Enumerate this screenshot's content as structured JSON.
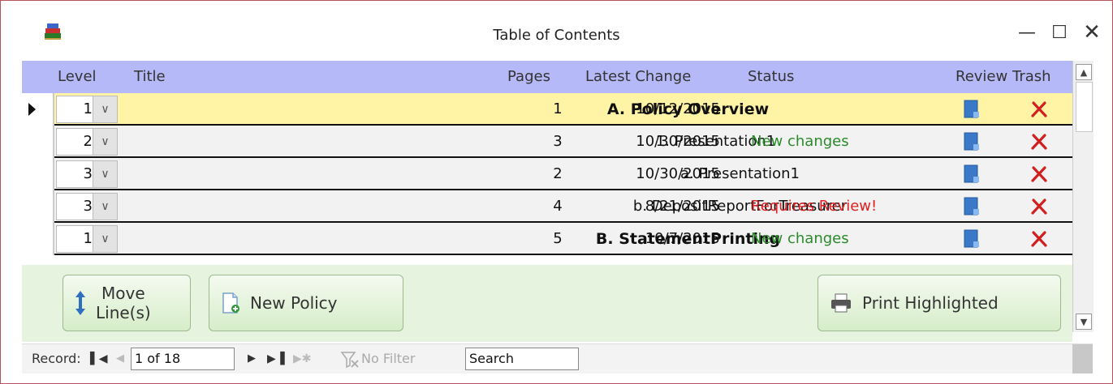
{
  "window": {
    "title": "Table of Contents",
    "minimize": "—",
    "maximize": "☐",
    "close": "✕"
  },
  "columns": {
    "level": "Level",
    "title": "Title",
    "pages": "Pages",
    "latest_change": "Latest Change",
    "status": "Status",
    "review": "Review",
    "trash": "Trash"
  },
  "rows": [
    {
      "level": "1",
      "title": "A. Policy Overview",
      "pages": "1",
      "date": "10/12/2015",
      "status": "",
      "status_type": "",
      "bold": true,
      "current": true
    },
    {
      "level": "2",
      "title": "1. Presentation1",
      "pages": "3",
      "date": "10/30/2015",
      "status": "New changes",
      "status_type": "green",
      "bold": false,
      "current": false
    },
    {
      "level": "3",
      "title": "a. Presentation1",
      "pages": "2",
      "date": "10/30/2015",
      "status": "",
      "status_type": "",
      "bold": false,
      "current": false
    },
    {
      "level": "3",
      "title": "b. DepositReportForTreasurer",
      "pages": "4",
      "date": "8/21/2015",
      "status": "Requires Review!",
      "status_type": "red",
      "bold": false,
      "current": false
    },
    {
      "level": "1",
      "title": "B. StatementPrinting",
      "pages": "5",
      "date": "10/7/2015",
      "status": "New changes",
      "status_type": "green",
      "bold": true,
      "current": false
    }
  ],
  "buttons": {
    "move_line1": "Move",
    "move_line2": "Line(s)",
    "new_policy": "New Policy",
    "print_highlighted": "Print Highlighted"
  },
  "record_nav": {
    "label": "Record:",
    "position": "1 of 18",
    "filter": "No Filter",
    "search": "Search"
  },
  "colors": {
    "header_bg": "#b6b9f8",
    "current_row_bg": "#fff4a6",
    "footer_bg": "#e6f4df",
    "status_green": "#2b8a2b",
    "status_red": "#e02020"
  }
}
